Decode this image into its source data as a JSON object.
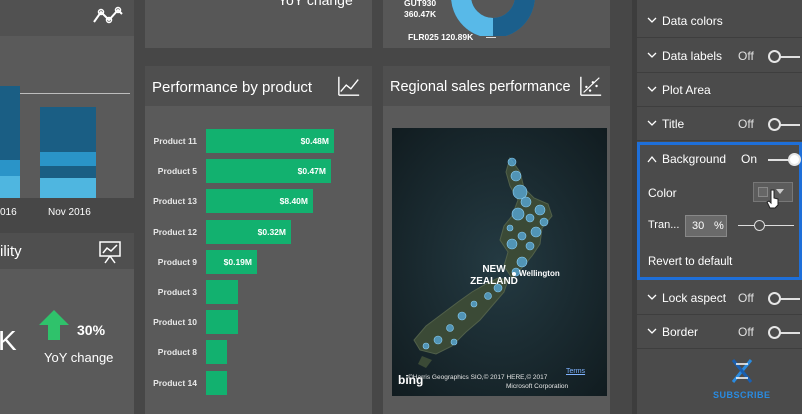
{
  "top_left_tile": {
    "x_labels": [
      "016",
      "Nov 2016"
    ]
  },
  "yoy_tile_top": {
    "text": "YoY change"
  },
  "donut_tile": {
    "labels": [
      "GUT930",
      "360.47K",
      "FLR025 120.89K"
    ]
  },
  "perf_tile": {
    "title": "Performance by product",
    "rows": [
      {
        "label": "Product 11",
        "value": 0.48,
        "value_label": "$0.48M"
      },
      {
        "label": "Product 5",
        "value": 0.47,
        "value_label": "$0.47M"
      },
      {
        "label": "Product 13",
        "value": 0.4,
        "value_label": "$8.40M"
      },
      {
        "label": "Product 12",
        "value": 0.32,
        "value_label": "$0.32M"
      },
      {
        "label": "Product 9",
        "value": 0.19,
        "value_label": "$0.19M"
      },
      {
        "label": "Product 3",
        "value": 0.12,
        "value_label": ""
      },
      {
        "label": "Product 10",
        "value": 0.12,
        "value_label": ""
      },
      {
        "label": "Product 8",
        "value": 0.08,
        "value_label": ""
      },
      {
        "label": "Product 14",
        "value": 0.08,
        "value_label": ""
      }
    ]
  },
  "region_tile": {
    "title": "Regional sales performance",
    "map_country": "NEW ZEALAND",
    "map_city": "Wellington",
    "terms": "Terms",
    "attribution": "©Harris Geographics SIO,© 2017 HERE,© 2017",
    "attribution2": "Microsoft Corporation",
    "bing": "bing"
  },
  "bottom_left_tile": {
    "title_fragment": "ility",
    "kpi_fragment": "K",
    "kpi_percent": "30%",
    "kpi_caption": "YoY change"
  },
  "format_pane": {
    "rows": [
      {
        "label": "Data colors",
        "state": "",
        "toggle": null,
        "expanded": false
      },
      {
        "label": "Data labels",
        "state": "Off",
        "toggle": "off",
        "expanded": false
      },
      {
        "label": "Plot Area",
        "state": "",
        "toggle": null,
        "expanded": false
      },
      {
        "label": "Title",
        "state": "Off",
        "toggle": "off",
        "expanded": false
      }
    ],
    "background": {
      "label": "Background",
      "state": "On",
      "color_label": "Color",
      "transparency_label": "Tran...",
      "transparency_value": "30",
      "transparency_unit": "%",
      "revert_label": "Revert to default"
    },
    "rows_after": [
      {
        "label": "Lock aspect",
        "state": "Off",
        "toggle": "off"
      },
      {
        "label": "Border",
        "state": "Off",
        "toggle": "off"
      }
    ],
    "subscribe": "SUBSCRIBE",
    "highlight_color": "#1e6fd9"
  }
}
